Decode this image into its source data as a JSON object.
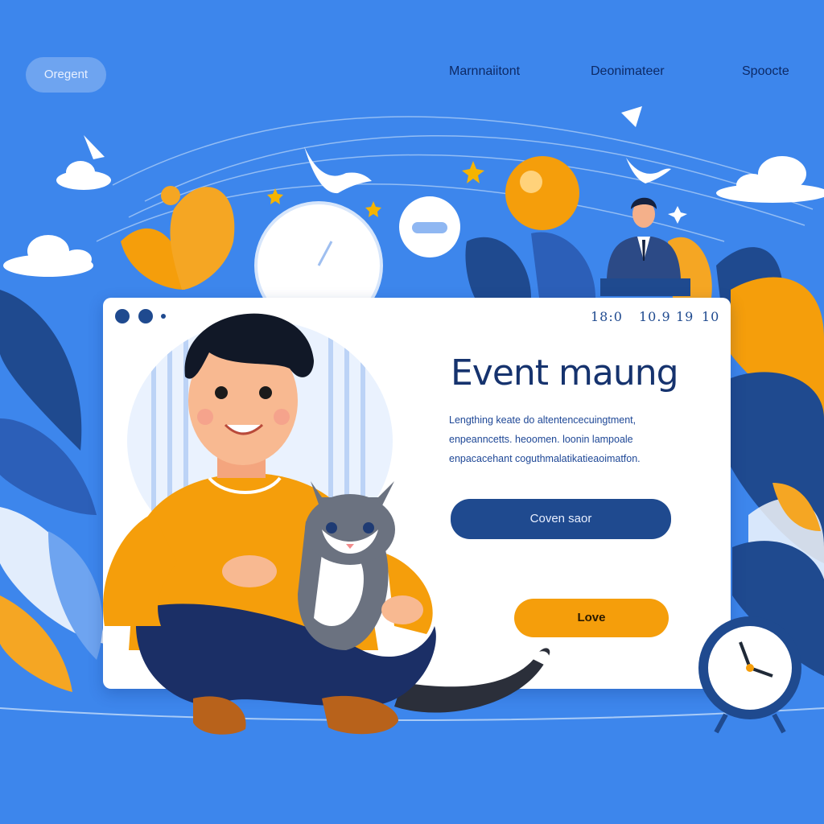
{
  "nav": {
    "logo_label": "Oregent",
    "links": [
      "Marnnaiitont",
      "Deonimateer",
      "Spoocte"
    ]
  },
  "window": {
    "stats": [
      "18:0",
      "10.9",
      "19",
      "10"
    ],
    "headline": "Event maung",
    "description_lines": [
      "Lengthing keate do altentencecuingtment,",
      "enpeanncetts. heoomen. loonin lampoale",
      "enpacacehant coguthmalatikatieaoimatfon."
    ],
    "primary_button": "Coven saor",
    "secondary_button": "Love"
  },
  "colors": {
    "background": "#3d86ec",
    "navy": "#1f4a8f",
    "orange": "#f59e0b",
    "white": "#ffffff"
  }
}
